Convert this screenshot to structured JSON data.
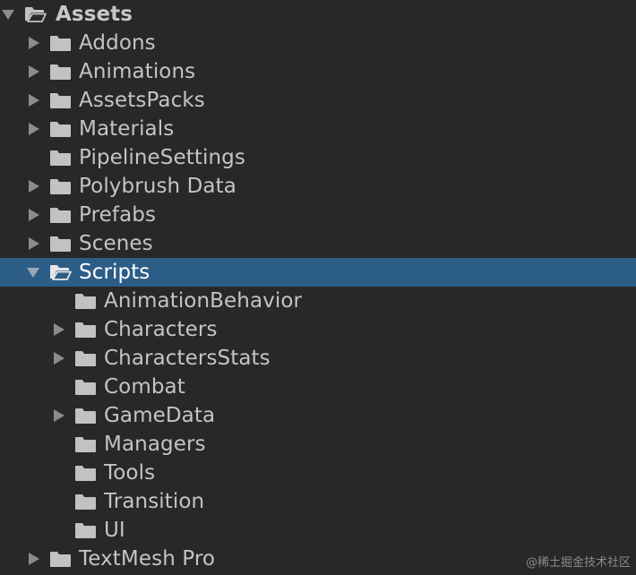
{
  "project": {
    "root": {
      "label": "Assets",
      "expanded": true
    },
    "items": [
      {
        "label": "Addons",
        "expandable": true
      },
      {
        "label": "Animations",
        "expandable": true
      },
      {
        "label": "AssetsPacks",
        "expandable": true
      },
      {
        "label": "Materials",
        "expandable": true
      },
      {
        "label": "PipelineSettings",
        "expandable": false
      },
      {
        "label": "Polybrush Data",
        "expandable": true
      },
      {
        "label": "Prefabs",
        "expandable": true
      },
      {
        "label": "Scenes",
        "expandable": true
      },
      {
        "label": "Scripts",
        "expandable": true,
        "expanded": true,
        "selected": true,
        "children": [
          {
            "label": "AnimationBehavior",
            "expandable": false
          },
          {
            "label": "Characters",
            "expandable": true
          },
          {
            "label": "CharactersStats",
            "expandable": true
          },
          {
            "label": "Combat",
            "expandable": false
          },
          {
            "label": "GameData",
            "expandable": true
          },
          {
            "label": "Managers",
            "expandable": false
          },
          {
            "label": "Tools",
            "expandable": false
          },
          {
            "label": "Transition",
            "expandable": false
          },
          {
            "label": "UI",
            "expandable": false
          }
        ]
      },
      {
        "label": "TextMesh Pro",
        "expandable": true
      }
    ]
  },
  "watermark": "@稀土掘金技术社区",
  "colors": {
    "background": "#282828",
    "selection": "#2c5d87",
    "text": "#c4c4c4",
    "icon": "#c2c2c2",
    "arrow": "#8c8c8c"
  }
}
